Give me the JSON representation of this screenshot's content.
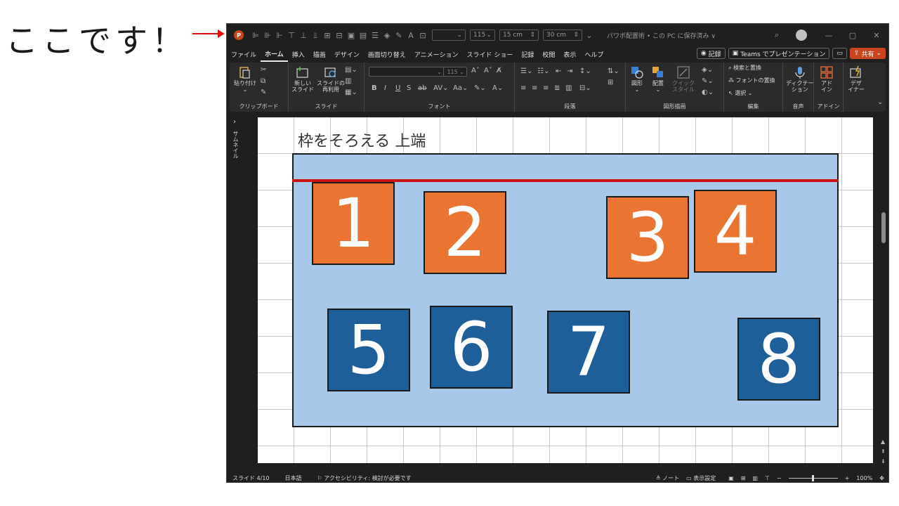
{
  "callout": {
    "text": "ここです！"
  },
  "titlebar": {
    "font_size": "115",
    "width_value": "15 cm",
    "height_value": "30 cm",
    "document_title": "パワポ配置術 • この PC に保存済み ∨"
  },
  "tabs": [
    {
      "label": "ファイル"
    },
    {
      "label": "ホーム"
    },
    {
      "label": "挿入"
    },
    {
      "label": "描画"
    },
    {
      "label": "デザイン"
    },
    {
      "label": "画面切り替え"
    },
    {
      "label": "アニメーション"
    },
    {
      "label": "スライド ショー"
    },
    {
      "label": "記録"
    },
    {
      "label": "校閲"
    },
    {
      "label": "表示"
    },
    {
      "label": "ヘルプ"
    }
  ],
  "tab_actions": {
    "record": "記録",
    "teams": "Teams でプレゼンテーション",
    "share": "共有"
  },
  "ribbon": {
    "paste": "貼り付け",
    "new_slide": "新しい\nスライド",
    "reuse_slide": "スライドの\n再利用",
    "font_size": "115",
    "shapes": "図形",
    "arrange": "配置",
    "quick_style": "クイック\nスタイル",
    "find_replace": "検索と置換",
    "font_replace": "フォントの置換",
    "select": "選択",
    "dictate": "ディクテー\nション",
    "addins": "アド\nイン",
    "designer": "デザ\nイナー",
    "groups": {
      "clipboard": "クリップボード",
      "slides": "スライド",
      "font": "フォント",
      "paragraph": "段落",
      "drawing": "図形描画",
      "editing": "編集",
      "voice": "音声",
      "addins": "アドイン"
    }
  },
  "sidebar": {
    "label": "サムネイル"
  },
  "slide": {
    "title": "枠をそろえる 上端",
    "boxes": [
      {
        "label": "1",
        "color": "orange"
      },
      {
        "label": "2",
        "color": "orange"
      },
      {
        "label": "3",
        "color": "orange"
      },
      {
        "label": "4",
        "color": "orange"
      },
      {
        "label": "5",
        "color": "blue"
      },
      {
        "label": "6",
        "color": "blue"
      },
      {
        "label": "7",
        "color": "blue"
      },
      {
        "label": "8",
        "color": "blue"
      }
    ]
  },
  "statusbar": {
    "slide_index": "スライド 4/10",
    "language": "日本語",
    "accessibility": "アクセシビリティ: 検討が必要です",
    "notes": "ノート",
    "display_settings": "表示設定",
    "zoom": "100%"
  },
  "colors": {
    "orange": "#ea7432",
    "blue": "#1f5f99",
    "frame": "#a8c8ea",
    "redline": "#cc1111"
  }
}
